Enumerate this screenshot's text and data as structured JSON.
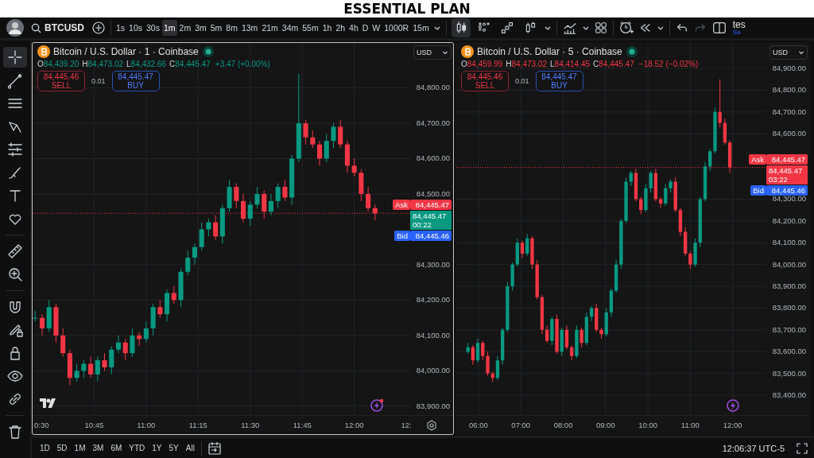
{
  "banner": {
    "title": "ESSENTIAL PLAN"
  },
  "toolbar": {
    "symbol": "BTCUSD",
    "intervals": [
      {
        "label": "1s",
        "selected": false
      },
      {
        "label": "10s",
        "selected": false
      },
      {
        "label": "30s",
        "selected": false
      },
      {
        "label": "1m",
        "selected": true
      },
      {
        "label": "2m",
        "selected": false
      },
      {
        "label": "3m",
        "selected": false
      },
      {
        "label": "5m",
        "selected": false
      },
      {
        "label": "8m",
        "selected": false
      },
      {
        "label": "13m",
        "selected": false
      },
      {
        "label": "21m",
        "selected": false
      },
      {
        "label": "34m",
        "selected": false
      },
      {
        "label": "55m",
        "selected": false
      },
      {
        "label": "1h",
        "selected": false
      },
      {
        "label": "2h",
        "selected": false
      },
      {
        "label": "4h",
        "selected": false
      },
      {
        "label": "D",
        "selected": false
      },
      {
        "label": "W",
        "selected": false
      },
      {
        "label": "1000R",
        "selected": false
      },
      {
        "label": "15m",
        "selected": false
      }
    ],
    "chart_styles": [
      {
        "selected": true
      },
      {
        "selected": false
      },
      {
        "selected": false
      },
      {
        "selected": false
      }
    ],
    "redo": {
      "disabled": true
    },
    "user": {
      "name": "tes",
      "status": "Sa"
    }
  },
  "drawing_tools": [
    {
      "selected": true
    },
    {
      "selected": false
    },
    {
      "selected": false
    },
    {
      "selected": false
    },
    {
      "selected": false
    },
    {
      "selected": false
    },
    {
      "selected": false
    },
    {
      "selected": false
    },
    {
      "selected": false
    },
    {
      "selected": false
    },
    {
      "selected": false
    },
    {
      "selected": false
    },
    {
      "selected": false
    },
    {
      "selected": false
    },
    {
      "selected": false
    },
    {
      "selected": false
    }
  ],
  "charts": [
    {
      "title": "Bitcoin / U.S. Dollar · 1 · Coinbase",
      "active": true,
      "color": "#089981",
      "ohlc": [
        {
          "label": "O",
          "value": "84,439.20"
        },
        {
          "label": "H",
          "value": "84,473.02"
        },
        {
          "label": "L",
          "value": "84,432.66"
        },
        {
          "label": "C",
          "value": "84,445.47"
        }
      ],
      "change": "+3.47 (+0.00%)",
      "sell": {
        "price": "84,445.46",
        "label": "SELL"
      },
      "quantity": "0.01",
      "buy": {
        "price": "84,445.47",
        "label": "BUY"
      },
      "currency": "USD",
      "chart_data": {
        "type": "candlestick",
        "x": [
          628,
          630,
          632,
          634,
          636,
          638,
          640,
          642,
          644,
          646,
          648,
          650,
          652,
          654,
          656,
          658,
          660,
          662,
          664,
          666,
          668,
          670,
          672,
          674,
          676,
          678,
          680,
          682,
          684,
          686,
          688,
          690,
          692,
          694,
          696,
          698,
          700,
          702,
          704,
          706,
          708,
          710,
          712,
          714,
          716,
          718,
          720,
          722,
          724,
          726
        ],
        "ohlc": [
          [
            84150,
            84170,
            84140,
            84150
          ],
          [
            84150,
            84160,
            84100,
            84120
          ],
          [
            84120,
            84200,
            84110,
            84180
          ],
          [
            84180,
            84190,
            84080,
            84100
          ],
          [
            84100,
            84120,
            84040,
            84050
          ],
          [
            84050,
            84060,
            83960,
            83980
          ],
          [
            83980,
            84020,
            83970,
            84000
          ],
          [
            84000,
            84030,
            83980,
            84020
          ],
          [
            84020,
            84040,
            83980,
            83990
          ],
          [
            83990,
            84040,
            83970,
            84030
          ],
          [
            84030,
            84050,
            84000,
            84010
          ],
          [
            84010,
            84070,
            83990,
            84060
          ],
          [
            84060,
            84100,
            84050,
            84080
          ],
          [
            84080,
            84090,
            84030,
            84050
          ],
          [
            84050,
            84120,
            84040,
            84100
          ],
          [
            84100,
            84110,
            84070,
            84090
          ],
          [
            84090,
            84140,
            84080,
            84120
          ],
          [
            84120,
            84190,
            84100,
            84180
          ],
          [
            84180,
            84200,
            84150,
            84160
          ],
          [
            84160,
            84230,
            84140,
            84220
          ],
          [
            84220,
            84240,
            84190,
            84200
          ],
          [
            84200,
            84290,
            84180,
            84280
          ],
          [
            84280,
            84340,
            84270,
            84320
          ],
          [
            84320,
            84360,
            84300,
            84350
          ],
          [
            84350,
            84420,
            84340,
            84400
          ],
          [
            84400,
            84430,
            84380,
            84420
          ],
          [
            84420,
            84440,
            84370,
            84380
          ],
          [
            84380,
            84470,
            84360,
            84460
          ],
          [
            84460,
            84540,
            84450,
            84520
          ],
          [
            84520,
            84530,
            84460,
            84480
          ],
          [
            84480,
            84500,
            84420,
            84430
          ],
          [
            84430,
            84480,
            84410,
            84470
          ],
          [
            84470,
            84520,
            84460,
            84500
          ],
          [
            84500,
            84510,
            84430,
            84450
          ],
          [
            84450,
            84500,
            84440,
            84480
          ],
          [
            84480,
            84530,
            84460,
            84520
          ],
          [
            84520,
            84540,
            84480,
            84490
          ],
          [
            84490,
            84610,
            84470,
            84600
          ],
          [
            84600,
            84840,
            84590,
            84700
          ],
          [
            84700,
            84710,
            84640,
            84660
          ],
          [
            84660,
            84680,
            84630,
            84640
          ],
          [
            84640,
            84650,
            84580,
            84600
          ],
          [
            84600,
            84670,
            84590,
            84650
          ],
          [
            84650,
            84700,
            84630,
            84690
          ],
          [
            84690,
            84710,
            84630,
            84640
          ],
          [
            84640,
            84650,
            84560,
            84580
          ],
          [
            84580,
            84600,
            84550,
            84560
          ],
          [
            84560,
            84570,
            84480,
            84500
          ],
          [
            84500,
            84520,
            84450,
            84460
          ],
          [
            84460,
            84470,
            84425,
            84445
          ]
        ],
        "xlim": [
          627.25,
          748.5
        ],
        "grid": true,
        "ref_lines": [
          {
            "value": 84445.47,
            "axis": "y",
            "color": "#f23645"
          }
        ],
        "ylim": [
          83875,
          84927
        ],
        "yticks": [
          {
            "value": 84800,
            "label": "84,800.00"
          },
          {
            "value": 84700,
            "label": "84,700.00"
          },
          {
            "value": 84600,
            "label": "84,600.00"
          },
          {
            "value": 84500,
            "label": "84,500.00"
          },
          {
            "value": 84300,
            "label": "84,300.00"
          },
          {
            "value": 84200,
            "label": "84,200.00"
          },
          {
            "value": 84100,
            "label": "84,100.00"
          },
          {
            "value": 84000,
            "label": "84,000.00"
          },
          {
            "value": 83900,
            "label": "83,900.00"
          }
        ],
        "xticks": [
          {
            "value": 645,
            "label": "10:45"
          },
          {
            "value": 660,
            "label": "11:00"
          },
          {
            "value": 675,
            "label": "11:15"
          },
          {
            "value": 690,
            "label": "11:30"
          },
          {
            "value": 705,
            "label": "11:45"
          },
          {
            "value": 720,
            "label": "12:00"
          }
        ]
      },
      "cut_time_labels": [
        "0:30",
        "12:"
      ],
      "ask": {
        "label": "Ask",
        "price": "84,445.47"
      },
      "last": {
        "price": "84,445.47",
        "countdown": "00:22"
      },
      "bid": {
        "label": "Bid",
        "price": "84,445.46"
      }
    },
    {
      "title": "Bitcoin / U.S. Dollar · 5 · Coinbase",
      "active": false,
      "color": "#f23645",
      "ohlc": [
        {
          "label": "O",
          "value": "84,459.99"
        },
        {
          "label": "H",
          "value": "84,473.02"
        },
        {
          "label": "L",
          "value": "84,414.45"
        },
        {
          "label": "C",
          "value": "84,445.47"
        }
      ],
      "change": "−18.52 (−0.02%)",
      "sell": {
        "price": "84,445.46",
        "label": "SELL"
      },
      "quantity": "0.01",
      "buy": {
        "price": "84,445.47",
        "label": "BUY"
      },
      "currency": "USD",
      "chart_data": {
        "type": "candlestick",
        "x": [
          345,
          352,
          359,
          366,
          373,
          380,
          387,
          394,
          401,
          408,
          415,
          422,
          429,
          436,
          443,
          450,
          457,
          464,
          471,
          478,
          485,
          492,
          499,
          506,
          513,
          520,
          527,
          534,
          541,
          548,
          555,
          562,
          569,
          576,
          583,
          590,
          597,
          604,
          611,
          618,
          625,
          632,
          639,
          646,
          653,
          660,
          667,
          674,
          681,
          688,
          695,
          702,
          709,
          716
        ],
        "ohlc": [
          [
            83600,
            83640,
            83590,
            83620
          ],
          [
            83620,
            83630,
            83540,
            83560
          ],
          [
            83560,
            83660,
            83550,
            83640
          ],
          [
            83640,
            83650,
            83560,
            83580
          ],
          [
            83580,
            83600,
            83490,
            83500
          ],
          [
            83500,
            83510,
            83460,
            83480
          ],
          [
            83480,
            83580,
            83470,
            83560
          ],
          [
            83560,
            83710,
            83540,
            83700
          ],
          [
            83700,
            83920,
            83690,
            83900
          ],
          [
            83900,
            84010,
            83880,
            84000
          ],
          [
            84000,
            84120,
            83990,
            84100
          ],
          [
            84100,
            84110,
            84030,
            84050
          ],
          [
            84050,
            84140,
            84040,
            84120
          ],
          [
            84120,
            84130,
            83980,
            84000
          ],
          [
            84000,
            84020,
            83840,
            83850
          ],
          [
            83850,
            83860,
            83680,
            83700
          ],
          [
            83700,
            83720,
            83640,
            83650
          ],
          [
            83650,
            83760,
            83630,
            83750
          ],
          [
            83750,
            83770,
            83590,
            83600
          ],
          [
            83600,
            83710,
            83580,
            83700
          ],
          [
            83700,
            83720,
            83610,
            83620
          ],
          [
            83620,
            83630,
            83560,
            83580
          ],
          [
            83580,
            83720,
            83570,
            83700
          ],
          [
            83700,
            83710,
            83620,
            83640
          ],
          [
            83640,
            83780,
            83630,
            83760
          ],
          [
            83760,
            83810,
            83740,
            83800
          ],
          [
            83800,
            83820,
            83690,
            83700
          ],
          [
            83700,
            83710,
            83660,
            83680
          ],
          [
            83680,
            83800,
            83670,
            83780
          ],
          [
            83780,
            83890,
            83760,
            83880
          ],
          [
            83880,
            84020,
            83870,
            84000
          ],
          [
            84000,
            84210,
            83980,
            84200
          ],
          [
            84200,
            84400,
            84190,
            84380
          ],
          [
            84380,
            84430,
            84360,
            84420
          ],
          [
            84420,
            84440,
            84290,
            84300
          ],
          [
            84300,
            84310,
            84230,
            84250
          ],
          [
            84250,
            84370,
            84240,
            84350
          ],
          [
            84350,
            84430,
            84330,
            84420
          ],
          [
            84420,
            84440,
            84290,
            84300
          ],
          [
            84300,
            84310,
            84260,
            84280
          ],
          [
            84280,
            84370,
            84270,
            84350
          ],
          [
            84350,
            84390,
            84330,
            84380
          ],
          [
            84380,
            84400,
            84240,
            84250
          ],
          [
            84250,
            84260,
            84130,
            84150
          ],
          [
            84150,
            84170,
            84040,
            84050
          ],
          [
            84050,
            84060,
            83980,
            84000
          ],
          [
            84000,
            84120,
            83990,
            84100
          ],
          [
            84100,
            84310,
            84080,
            84300
          ],
          [
            84300,
            84470,
            84290,
            84450
          ],
          [
            84450,
            84530,
            84430,
            84520
          ],
          [
            84520,
            84720,
            84510,
            84700
          ],
          [
            84700,
            84850,
            84630,
            84650
          ],
          [
            84650,
            84670,
            84550,
            84560
          ],
          [
            84560,
            84570,
            84420,
            84445
          ]
        ],
        "xlim": [
          328.5,
          828.5
        ],
        "grid": true,
        "ref_lines": [
          {
            "value": 84445.47,
            "axis": "y",
            "color": "#f23645"
          }
        ],
        "ylim": [
          83309,
          85017
        ],
        "yticks": [
          {
            "value": 84900,
            "label": "84,900.00"
          },
          {
            "value": 84800,
            "label": "84,800.00"
          },
          {
            "value": 84700,
            "label": "84,700.00"
          },
          {
            "value": 84600,
            "label": "84,600.00"
          },
          {
            "value": 84300,
            "label": "84,300.00"
          },
          {
            "value": 84200,
            "label": "84,200.00"
          },
          {
            "value": 84100,
            "label": "84,100.00"
          },
          {
            "value": 84000,
            "label": "84,000.00"
          },
          {
            "value": 83900,
            "label": "83,900.00"
          },
          {
            "value": 83800,
            "label": "83,800.00"
          },
          {
            "value": 83700,
            "label": "83,700.00"
          },
          {
            "value": 83600,
            "label": "83,600.00"
          },
          {
            "value": 83500,
            "label": "83,500.00"
          },
          {
            "value": 83400,
            "label": "83,400.00"
          }
        ],
        "xticks": [
          {
            "value": 360,
            "label": "06:00"
          },
          {
            "value": 420,
            "label": "07:00"
          },
          {
            "value": 480,
            "label": "08:00"
          },
          {
            "value": 540,
            "label": "09:00"
          },
          {
            "value": 600,
            "label": "10:00"
          },
          {
            "value": 660,
            "label": "11:00"
          },
          {
            "value": 720,
            "label": "12:00"
          }
        ]
      },
      "ask": {
        "label": "Ask",
        "price": "84,445.47"
      },
      "last": {
        "price": "84,445.47",
        "countdown": "03:22"
      },
      "bid": {
        "label": "Bid",
        "price": "84,445.46"
      }
    }
  ],
  "ranges": [
    "1D",
    "5D",
    "1M",
    "3M",
    "6M",
    "YTD",
    "1Y",
    "5Y",
    "All"
  ],
  "clock": "12:06:37 UTC-5"
}
